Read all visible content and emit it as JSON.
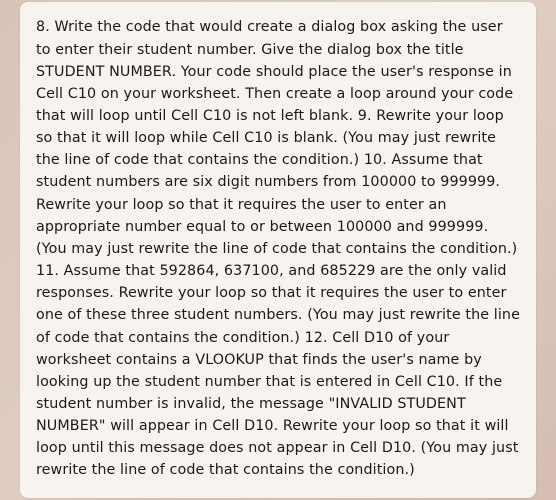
{
  "body_text": "8. Write the code that would create a dialog box asking the user to enter their student number. Give the dialog box the title STUDENT NUMBER. Your code should place the user's response in Cell C10 on your worksheet. Then create a loop around your code that will loop until Cell C10 is not left blank. 9. Rewrite your loop so that it will loop while Cell C10 is blank. (You may just rewrite the line of code that contains the condition.) 10. Assume that student numbers are six digit numbers from 100000 to 999999. Rewrite your loop so that it requires the user to enter an appropriate number equal to or between 100000 and 999999. (You may just rewrite the line of code that contains the condition.) 11. Assume that 592864, 637100, and 685229 are the only valid responses. Rewrite your loop so that it requires the user to enter one of these three student numbers. (You may just rewrite the line of code that contains the condition.) 12. Cell D10 of your worksheet contains a VLOOKUP that finds the user's name by looking up the student number that is entered in Cell C10. If the student number is invalid, the message \"INVALID STUDENT NUMBER\" will appear in Cell D10. Rewrite your loop so that it will loop until this message does not appear in Cell D10. (You may just rewrite the line of code that contains the condition.)"
}
